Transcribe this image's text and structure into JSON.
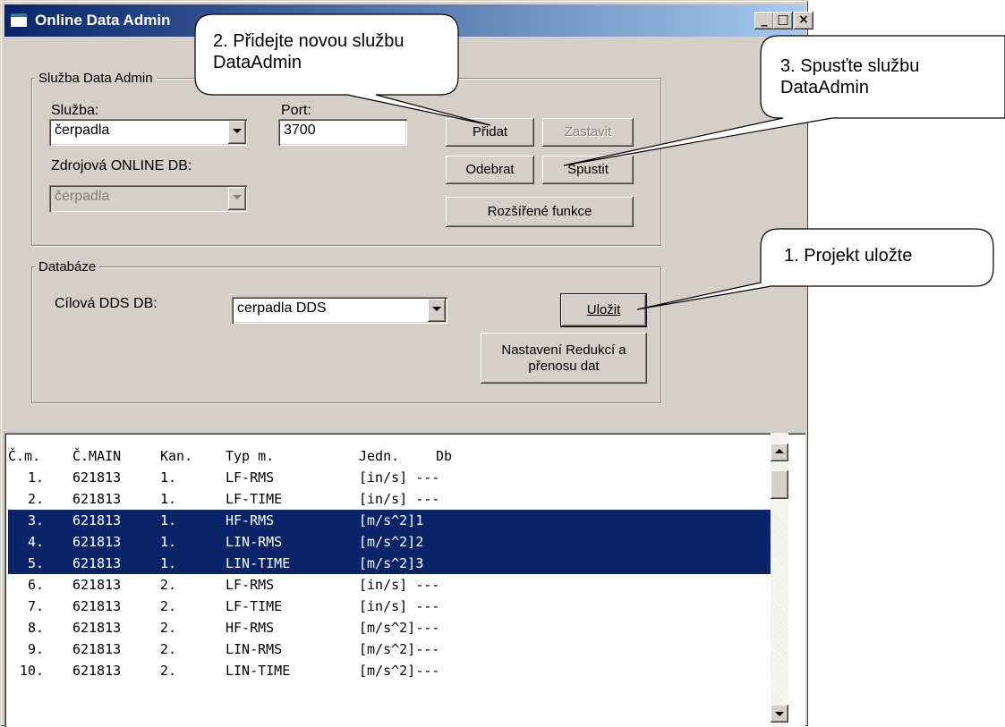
{
  "window": {
    "title": "Online Data Admin"
  },
  "service_group": {
    "legend": "Služba Data Admin",
    "service_label": "Služba:",
    "service_value": "čerpadla",
    "port_label": "Port:",
    "port_value": "3700",
    "source_db_label": "Zdrojová ONLINE DB:",
    "source_db_value": "čerpadla",
    "buttons": {
      "add": "Přidat",
      "stop": "Zastavit",
      "remove": "Odebrat",
      "start": "Spustit",
      "extended": "Rozšířené funkce"
    }
  },
  "database_group": {
    "legend": "Databáze",
    "target_label": "Cílová DDS DB:",
    "target_value": "cerpadla DDS",
    "save_button": "Uložit",
    "reduction_button": "Nastavení Redukcí a přenosu dat"
  },
  "list": {
    "headers": [
      "Č.m.",
      "Č.MAIN",
      "Kan.",
      "Typ m.",
      "Jedn.",
      "Db"
    ],
    "rows": [
      {
        "num": "1.",
        "main": "621813",
        "ch": "1.",
        "type": "LF-RMS",
        "unit": "[in/s]",
        "db": "---",
        "selected": false
      },
      {
        "num": "2.",
        "main": "621813",
        "ch": "1.",
        "type": "LF-TIME",
        "unit": "[in/s]",
        "db": "---",
        "selected": false
      },
      {
        "num": "3.",
        "main": "621813",
        "ch": "1.",
        "type": "HF-RMS",
        "unit": "[m/s^2]",
        "db": "1",
        "selected": true
      },
      {
        "num": "4.",
        "main": "621813",
        "ch": "1.",
        "type": "LIN-RMS",
        "unit": "[m/s^2]",
        "db": "2",
        "selected": true
      },
      {
        "num": "5.",
        "main": "621813",
        "ch": "1.",
        "type": "LIN-TIME",
        "unit": "[m/s^2]",
        "db": "3",
        "selected": true
      },
      {
        "num": "6.",
        "main": "621813",
        "ch": "2.",
        "type": "LF-RMS",
        "unit": "[in/s]",
        "db": "---",
        "selected": false
      },
      {
        "num": "7.",
        "main": "621813",
        "ch": "2.",
        "type": "LF-TIME",
        "unit": "[in/s]",
        "db": "---",
        "selected": false
      },
      {
        "num": "8.",
        "main": "621813",
        "ch": "2.",
        "type": "HF-RMS",
        "unit": "[m/s^2]",
        "db": "---",
        "selected": false
      },
      {
        "num": "9.",
        "main": "621813",
        "ch": "2.",
        "type": "LIN-RMS",
        "unit": "[m/s^2]",
        "db": "---",
        "selected": false
      },
      {
        "num": "10.",
        "main": "621813",
        "ch": "2.",
        "type": "LIN-TIME",
        "unit": "[m/s^2]",
        "db": "---",
        "selected": false
      }
    ]
  },
  "callouts": {
    "add_service": "2. Přidejte novou službu DataAdmin",
    "start_service": "3. Spusťte službu DataAdmin",
    "save_project": "1. Projekt uložte"
  },
  "colors": {
    "selection": "#0a246a",
    "titlebar": "#0a246a",
    "face": "#d4d0c8"
  }
}
